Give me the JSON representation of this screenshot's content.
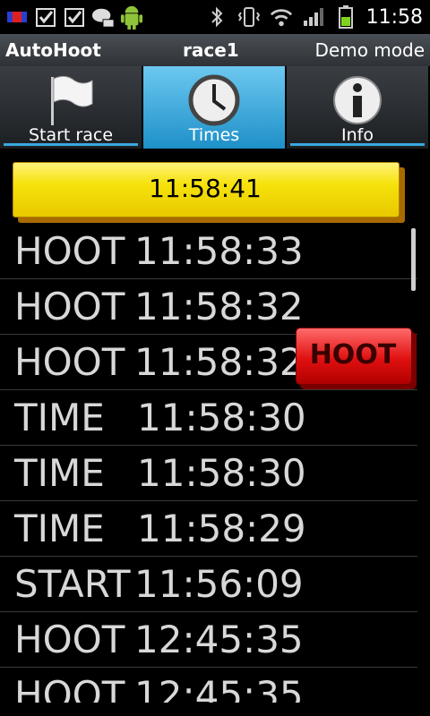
{
  "statusbar": {
    "time": "11:58",
    "left_icons": [
      "flag-icon",
      "checkbox-icon",
      "checkbox-icon",
      "chat-icon",
      "android-icon"
    ],
    "right_icons": [
      "bluetooth-icon",
      "vibrate-icon",
      "wifi-icon",
      "signal-icon",
      "battery-icon"
    ]
  },
  "titlebar": {
    "app_name": "AutoHoot",
    "race_name": "race1",
    "mode": "Demo mode"
  },
  "tabs": [
    {
      "label": "Start race",
      "icon": "flag-icon",
      "active": false
    },
    {
      "label": "Times",
      "icon": "clock-icon",
      "active": true
    },
    {
      "label": "Info",
      "icon": "info-icon",
      "active": false
    }
  ],
  "current_time": "11:58:41",
  "log": [
    {
      "kind": "HOOT",
      "time": "11:58:33"
    },
    {
      "kind": "HOOT",
      "time": "11:58:32"
    },
    {
      "kind": "HOOT",
      "time": "11:58:32"
    },
    {
      "kind": "TIME",
      "time": "11:58:30"
    },
    {
      "kind": "TIME",
      "time": "11:58:30"
    },
    {
      "kind": "TIME",
      "time": "11:58:29"
    },
    {
      "kind": "START",
      "time": "11:56:09"
    },
    {
      "kind": "HOOT",
      "time": "12:45:35"
    },
    {
      "kind": "HOOT",
      "time": "12:45:35"
    }
  ],
  "hoot_button": {
    "label": "HOOT"
  },
  "colors": {
    "banner": "#f6e20a",
    "hoot": "#e01010",
    "tab_active": "#1e90c8"
  }
}
